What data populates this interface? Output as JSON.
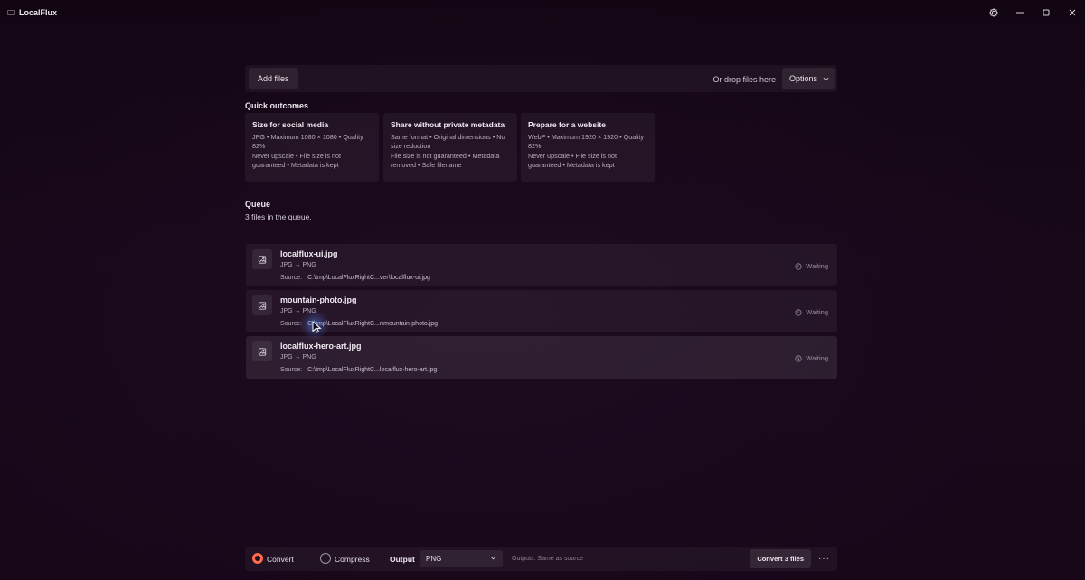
{
  "window": {
    "title": "LocalFlux"
  },
  "topbar": {
    "add_files_label": "Add files",
    "drop_text": "Or drop files here",
    "options_label": "Options"
  },
  "quick_outcomes": {
    "title": "Quick outcomes",
    "cards": [
      {
        "title": "Size for social media",
        "line1": "JPG • Maximum 1080 × 1080 • Quality 82%",
        "line2": "Never upscale • File size is not guaranteed • Metadata is kept"
      },
      {
        "title": "Share without private metadata",
        "line1": "Same format • Original dimensions • No size reduction",
        "line2": "File size is not guaranteed • Metadata removed • Safe filename"
      },
      {
        "title": "Prepare for a website",
        "line1": "WebP • Maximum 1920 × 1920 • Quality 82%",
        "line2": "Never upscale • File size is not guaranteed • Metadata is kept"
      }
    ]
  },
  "queue": {
    "title": "Queue",
    "summary": "3 files in the queue.",
    "items": [
      {
        "name": "localflux-ui.jpg",
        "conversion": "JPG → PNG",
        "source_label": "Source:",
        "source_path": "C:\\tmp\\LocalFluxRightC...ver\\localflux-ui.jpg",
        "status": "Waiting"
      },
      {
        "name": "mountain-photo.jpg",
        "conversion": "JPG → PNG",
        "source_label": "Source:",
        "source_path": "C:\\tmp\\LocalFluxRightC...r\\mountain-photo.jpg",
        "status": "Waiting"
      },
      {
        "name": "localflux-hero-art.jpg",
        "conversion": "JPG → PNG",
        "source_label": "Source:",
        "source_path": "C:\\tmp\\LocalFluxRightC...localflux-hero-art.jpg",
        "status": "Waiting"
      }
    ]
  },
  "bottombar": {
    "mode_convert": "Convert",
    "mode_compress": "Compress",
    "selected_mode": "Convert",
    "output_label": "Output",
    "output_format": "PNG",
    "outputs_note": "Outputs: Same as source",
    "convert_button": "Convert 3 files",
    "more_label": "···"
  },
  "colors": {
    "accent": "#ff6b4a",
    "background": "#170719"
  }
}
